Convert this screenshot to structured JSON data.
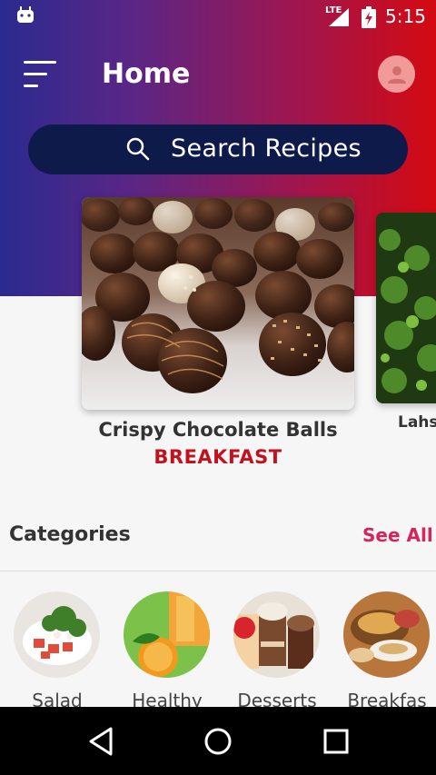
{
  "status_bar": {
    "network": "LTE",
    "time": "5:15"
  },
  "header": {
    "title": "Home"
  },
  "search": {
    "placeholder": "Search Recipes"
  },
  "featured": [
    {
      "name": "Crispy Chocolate Balls",
      "category": "BREAKFAST"
    },
    {
      "name": "Lahs"
    }
  ],
  "categories": {
    "title": "Categories",
    "see_all": "See All",
    "items": [
      {
        "label": "Salad"
      },
      {
        "label": "Healthy"
      },
      {
        "label": "Desserts"
      },
      {
        "label": "Breakfas"
      }
    ]
  },
  "colors": {
    "gradient_start": "#2b2a8f",
    "gradient_end": "#d40a12",
    "search_bg": "#0d1a4a",
    "accent_red": "#c1121f",
    "see_all": "#d6235a"
  },
  "icons": [
    "android-icon",
    "signal-icon",
    "battery-icon",
    "menu-icon",
    "avatar-icon",
    "search-icon",
    "back-icon",
    "home-icon",
    "recents-icon"
  ]
}
